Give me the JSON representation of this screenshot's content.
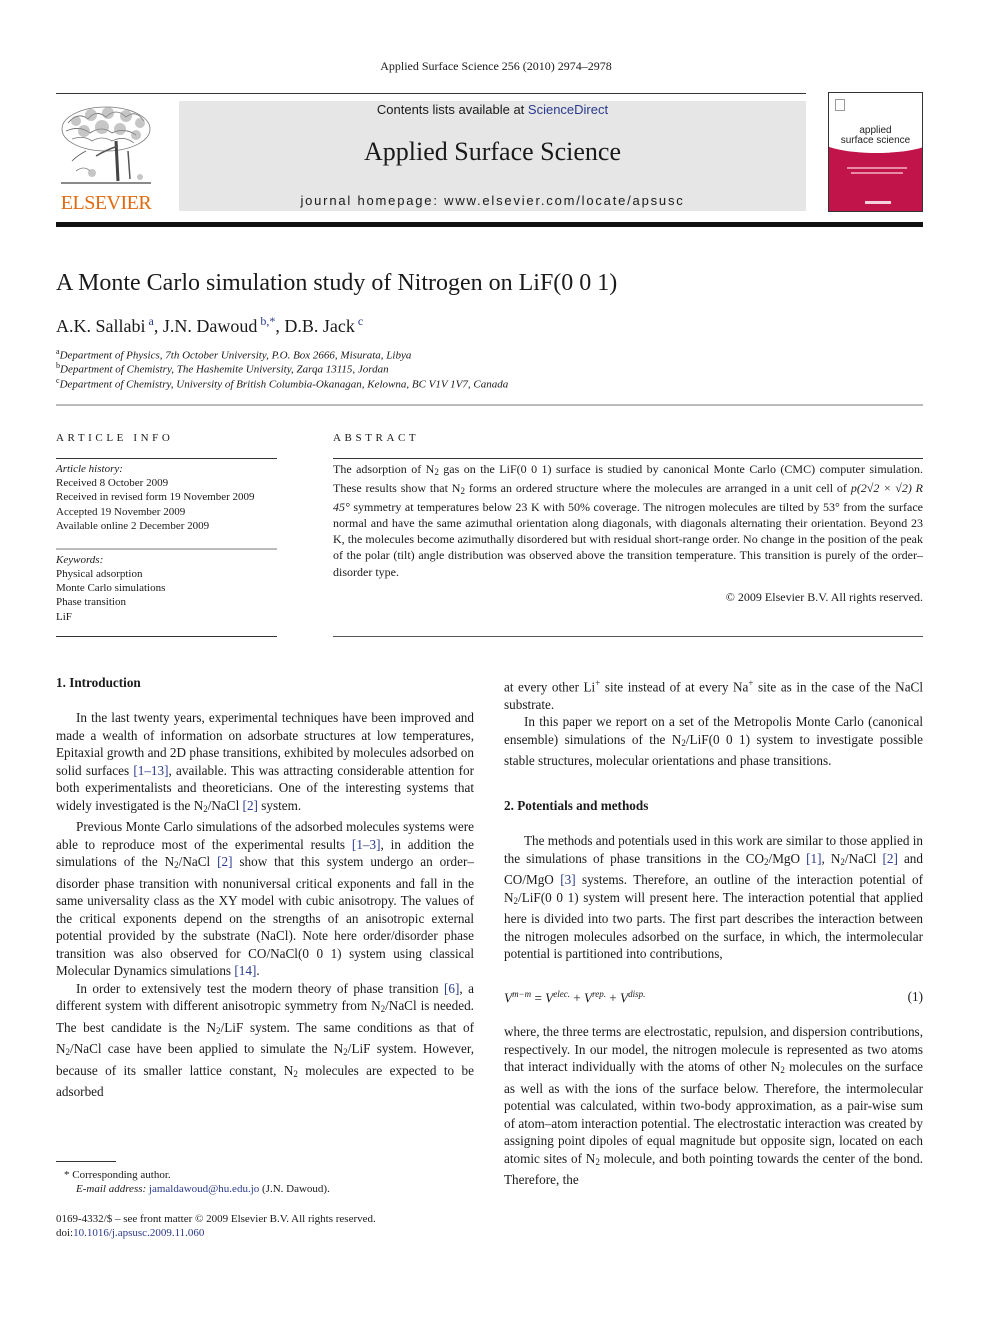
{
  "running_head": "Applied Surface Science 256 (2010) 2974–2978",
  "publisher": {
    "wordmark": "ELSEVIER",
    "logo_icon": "elsevier-tree-icon"
  },
  "masthead": {
    "contents_prefix": "Contents lists available at ",
    "contents_link": "ScienceDirect",
    "journal_name": "Applied Surface Science",
    "homepage": "journal homepage: www.elsevier.com/locate/apsusc"
  },
  "cover": {
    "title_line1": "applied",
    "title_line2": "surface science"
  },
  "article": {
    "title": "A Monte Carlo simulation study of Nitrogen on LiF(0 0 1)",
    "authors": [
      {
        "name": "A.K. Sallabi",
        "sup": "a"
      },
      {
        "name": "J.N. Dawoud",
        "sup": "b,*"
      },
      {
        "name": "D.B. Jack",
        "sup": "c"
      }
    ],
    "author_separator": ", ",
    "affiliations": [
      {
        "sup": "a",
        "text": "Department of Physics, 7th October University, P.O. Box 2666, Misurata, Libya"
      },
      {
        "sup": "b",
        "text": "Department of Chemistry, The Hashemite University, Zarqa 13115, Jordan"
      },
      {
        "sup": "c",
        "text": "Department of Chemistry, University of British Columbia-Okanagan, Kelowna, BC V1V 1V7, Canada"
      }
    ]
  },
  "article_info": {
    "heading": "ARTICLE INFO",
    "history_label": "Article history:",
    "history": [
      "Received 8 October 2009",
      "Received in revised form 19 November 2009",
      "Accepted 19 November 2009",
      "Available online 2 December 2009"
    ],
    "keywords_label": "Keywords:",
    "keywords": [
      "Physical adsorption",
      "Monte Carlo simulations",
      "Phase transition",
      "LiF"
    ]
  },
  "abstract": {
    "heading": "ABSTRACT",
    "p1": "The adsorption of N",
    "p1_sub": "2",
    "p2": " gas on the LiF(0 0 1) surface is studied by canonical Monte Carlo (CMC) computer simulation. These results show that N",
    "p2_sub": "2",
    "p3": " forms an ordered structure where the molecules are arranged in a unit cell of ",
    "symmetry": "p(2√2 × √2) R 45°",
    "p4": " symmetry at temperatures below 23 K with 50% coverage. The nitrogen molecules are tilted by 53° from the surface normal and have the same azimuthal orientation along diagonals, with diagonals alternating their orientation. Beyond 23 K, the molecules become azimuthally disordered but with residual short-range order. No change in the position of the peak of the polar (tilt) angle distribution was observed above the transition temperature. This transition is purely of the order–disorder type.",
    "copyright": "© 2009 Elsevier B.V. All rights reserved."
  },
  "intro": {
    "heading": "1.  Introduction",
    "para1": {
      "a": "In the last twenty years, experimental techniques have been improved and made a wealth of information on adsorbate structures at low temperatures, Epitaxial growth and 2D phase transitions, exhibited by molecules adsorbed on solid surfaces ",
      "ref1": "[1–13]",
      "b": ", available. This was attracting considerable attention for both experimentalists and theoreticians. One of the interesting systems that widely investigated is the N",
      "sub1": "2",
      "c": "/NaCl ",
      "ref2": "[2]",
      "d": " system."
    },
    "para2": {
      "a": "Previous Monte Carlo simulations of the adsorbed molecules systems were able to reproduce most of the experimental results ",
      "ref1": "[1–3]",
      "b": ", in addition the simulations of the N",
      "sub1": "2",
      "c": "/NaCl ",
      "ref2": "[2]",
      "d": " show that this system undergo an order–disorder phase transition with nonuniversal critical exponents and fall in the same universality class as the XY model with cubic anisotropy. The values of the critical exponents depend on the strengths of an anisotropic external potential provided by the substrate (NaCl). Note here order/disorder phase transition was also observed for CO/NaCl(0 0 1) system using classical Molecular Dynamics simulations ",
      "ref3": "[14]",
      "e": "."
    },
    "para3": {
      "a": "In order to extensively test the modern theory of phase transition ",
      "ref1": "[6]",
      "b": ", a different system with different anisotropic symmetry from N",
      "sub1": "2",
      "c": "/NaCl is needed. The best candidate is the N",
      "sub2": "2",
      "d": "/LiF system. The same conditions as that of N",
      "sub3": "2",
      "e": "/NaCl case have been applied to simulate the N",
      "sub4": "2",
      "f": "/LiF system. However, because of its smaller lattice constant, N",
      "sub5": "2",
      "g": " molecules are expected to be adsorbed"
    },
    "right_cont": {
      "a": "at every other Li",
      "sup1": "+",
      "b": " site instead of at every Na",
      "sup2": "+",
      "c": " site as in the case of the NaCl substrate."
    },
    "para4": {
      "a": "In this paper we report on a set of the Metropolis Monte Carlo (canonical ensemble) simulations of the N",
      "sub1": "2",
      "b": "/LiF(0 0 1) system to investigate possible stable structures, molecular orientations and phase transitions."
    }
  },
  "methods": {
    "heading": "2.  Potentials and methods",
    "para1": {
      "a": "The methods and potentials used in this work are similar to those applied in the simulations of phase transitions in the CO",
      "sub1": "2",
      "b": "/MgO ",
      "ref1": "[1]",
      "c": ", N",
      "sub2": "2",
      "d": "/NaCl ",
      "ref2": "[2]",
      "e": " and CO/MgO ",
      "ref3": "[3]",
      "f": " systems. Therefore, an outline of the interaction potential of N",
      "sub3": "2",
      "g": "/LiF(0 0 1) system will present here. The interaction potential that applied here is divided into two parts. The first part describes the interaction between the nitrogen molecules adsorbed on the surface, in which, the intermolecular potential is partitioned into contributions,"
    },
    "equation": {
      "lhs": "V",
      "lhs_sup": "m−m",
      "eq": " = ",
      "t1": "V",
      "t1_sup": "elec.",
      "plus": " + ",
      "t2": "V",
      "t2_sup": "rep.",
      "t3": "V",
      "t3_sup": "disp.",
      "number": "(1)"
    },
    "para2": {
      "a": "where, the three terms are electrostatic, repulsion, and dispersion contributions, respectively. In our model, the nitrogen molecule is represented as two atoms that interact individually with the atoms of other N",
      "sub1": "2",
      "b": " molecules on the surface as well as with the ions of the surface below. Therefore, the intermolecular potential was calculated, within two-body approximation, as a pair-wise sum of atom–atom interaction potential. The electrostatic interaction was created by assigning point dipoles of equal magnitude but opposite sign, located on each atomic sites of N",
      "sub2": "2",
      "c": " molecule, and both pointing towards the center of the bond. Therefore, the"
    }
  },
  "footnotes": {
    "corresponding": "*  Corresponding author.",
    "email_label": "E-mail address: ",
    "email": "jamaldawoud@hu.edu.jo",
    "email_suffix": " (J.N. Dawoud).",
    "front_matter": "0169-4332/$ – see front matter © 2009 Elsevier B.V. All rights reserved.",
    "doi_prefix": "doi:",
    "doi": "10.1016/j.apsusc.2009.11.060"
  }
}
